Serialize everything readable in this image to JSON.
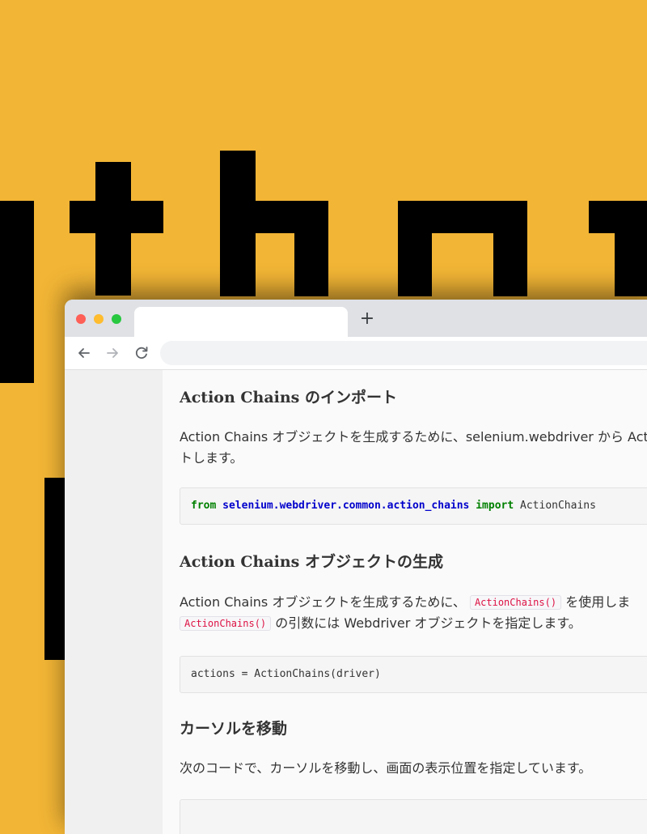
{
  "background": {
    "color": "#f2b535",
    "logo_icon": "python-pixel-lettering"
  },
  "browser": {
    "new_tab_label": "+",
    "toolbar": {
      "back_icon": "arrow-left-icon",
      "forward_icon": "arrow-right-icon",
      "reload_icon": "reload-icon"
    }
  },
  "article": {
    "sections": [
      {
        "heading": "Action Chains のインポート",
        "paragraph_line1": "Action Chains オブジェクトを生成するために、selenium.webdriver から Act",
        "paragraph_line2": "トします。",
        "code": {
          "kw_from": "from",
          "module": "selenium.webdriver.common.action_chains",
          "kw_import": "import",
          "name": "ActionChains"
        }
      },
      {
        "heading": "Action Chains オブジェクトの生成",
        "paragraph_line1_prefix": "Action Chains オブジェクトを生成するために、",
        "inline_code": "ActionChains()",
        "paragraph_line1_suffix": "を使用しま",
        "paragraph_line2_inline_code": "ActionChains()",
        "paragraph_line2_suffix": "の引数には Webdriver オブジェクトを指定します。",
        "code": "actions = ActionChains(driver)"
      },
      {
        "heading": "カーソルを移動",
        "paragraph": "次のコードで、カーソルを移動し、画面の表示位置を指定しています。"
      }
    ]
  }
}
